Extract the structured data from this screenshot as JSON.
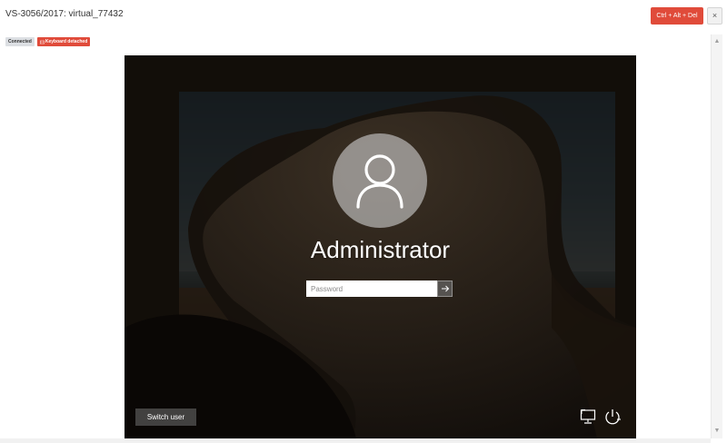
{
  "window": {
    "title": "VS-3056/2017: virtual_77432",
    "cad_label": "Ctrl + Alt + Del",
    "close_label": "×"
  },
  "badges": {
    "connected": "Connected",
    "keyboard": "Keyboard detached",
    "keyboard_icon": "keyboard-icon"
  },
  "login": {
    "username": "Administrator",
    "password_placeholder": "Password",
    "password_value": "",
    "submit_icon": "arrow-right-icon",
    "switch_user_label": "Switch user",
    "ease_icon": "ease-of-access-icon",
    "power_icon": "power-icon",
    "avatar_icon": "user-silhouette-icon"
  },
  "colors": {
    "accent_red": "#e04b3a",
    "badge_gray": "#dcdfe3",
    "avatar_gray": "#cdcdcd"
  }
}
